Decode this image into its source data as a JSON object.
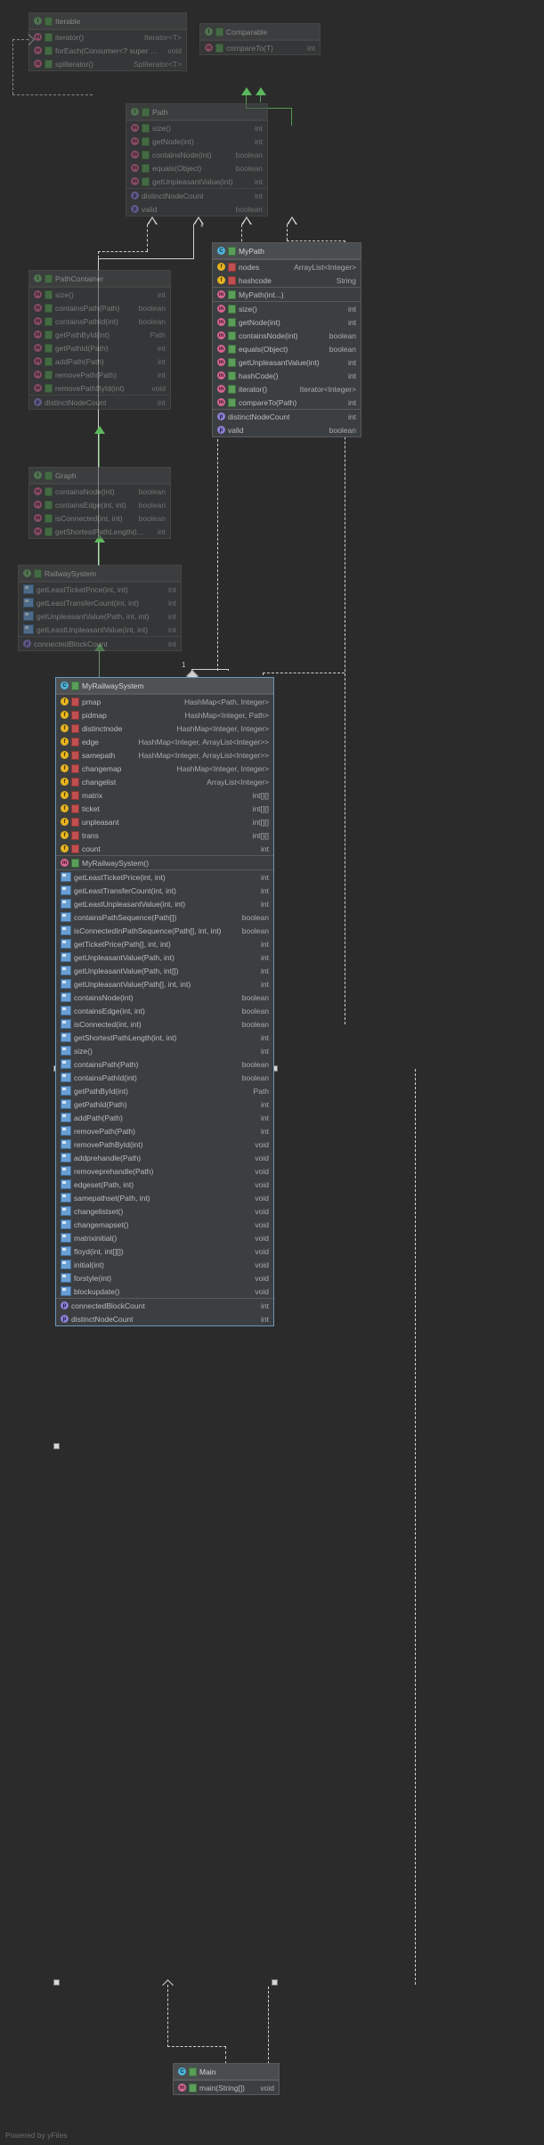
{
  "footer": {
    "text": "Powered by yFiles"
  },
  "classes": {
    "iterable": {
      "name": "Iterable",
      "kind": "interface",
      "members": [
        {
          "name": "iterator()",
          "type": "Iterator<T>",
          "icon": "method-icon",
          "vis": "public"
        },
        {
          "name": "forEach(Consumer<? super T>)",
          "type": "void",
          "icon": "method-icon",
          "vis": "public"
        },
        {
          "name": "spliterator()",
          "type": "Spliterator<T>",
          "icon": "method-icon",
          "vis": "public"
        }
      ]
    },
    "comparable": {
      "name": "Comparable",
      "kind": "interface",
      "members": [
        {
          "name": "compareTo(T)",
          "type": "int",
          "icon": "method-icon",
          "vis": "public"
        }
      ]
    },
    "path": {
      "name": "Path",
      "kind": "interface",
      "methods": [
        {
          "name": "size()",
          "type": "int",
          "icon": "method-icon",
          "vis": "public"
        },
        {
          "name": "getNode(int)",
          "type": "int",
          "icon": "method-icon",
          "vis": "public"
        },
        {
          "name": "containsNode(int)",
          "type": "boolean",
          "icon": "method-icon",
          "vis": "public"
        },
        {
          "name": "equals(Object)",
          "type": "boolean",
          "icon": "method-icon",
          "vis": "public"
        },
        {
          "name": "getUnpleasantValue(int)",
          "type": "int",
          "icon": "method-icon",
          "vis": "public"
        }
      ],
      "props": [
        {
          "name": "distinctNodeCount",
          "type": "int",
          "icon": "property-icon"
        },
        {
          "name": "valid",
          "type": "boolean",
          "icon": "property-icon"
        }
      ]
    },
    "pathcontainer": {
      "name": "PathContainer",
      "kind": "interface",
      "methods": [
        {
          "name": "size()",
          "type": "int",
          "icon": "method-icon",
          "vis": "public"
        },
        {
          "name": "containsPath(Path)",
          "type": "boolean",
          "icon": "method-icon",
          "vis": "public"
        },
        {
          "name": "containsPathId(int)",
          "type": "boolean",
          "icon": "method-icon",
          "vis": "public"
        },
        {
          "name": "getPathById(int)",
          "type": "Path",
          "icon": "method-icon",
          "vis": "public"
        },
        {
          "name": "getPathId(Path)",
          "type": "int",
          "icon": "method-icon",
          "vis": "public"
        },
        {
          "name": "addPath(Path)",
          "type": "int",
          "icon": "method-icon",
          "vis": "public"
        },
        {
          "name": "removePath(Path)",
          "type": "int",
          "icon": "method-icon",
          "vis": "public"
        },
        {
          "name": "removePathById(int)",
          "type": "void",
          "icon": "method-icon",
          "vis": "public"
        }
      ],
      "props": [
        {
          "name": "distinctNodeCount",
          "type": "int",
          "icon": "property-icon"
        }
      ]
    },
    "graph": {
      "name": "Graph",
      "kind": "interface",
      "methods": [
        {
          "name": "containsNode(int)",
          "type": "boolean",
          "icon": "method-icon",
          "vis": "public"
        },
        {
          "name": "containsEdge(int, int)",
          "type": "boolean",
          "icon": "method-icon",
          "vis": "public"
        },
        {
          "name": "isConnected(int, int)",
          "type": "boolean",
          "icon": "method-icon",
          "vis": "public"
        },
        {
          "name": "getShortestPathLength(int, int)",
          "type": "int",
          "icon": "method-icon",
          "vis": "public"
        }
      ]
    },
    "railwaysystem": {
      "name": "RailwaySystem",
      "kind": "interface",
      "methods": [
        {
          "name": "getLeastTicketPrice(int, int)",
          "type": "int",
          "icon": "override-icon"
        },
        {
          "name": "getLeastTransferCount(int, int)",
          "type": "int",
          "icon": "override-icon"
        },
        {
          "name": "getUnpleasantValue(Path, int, int)",
          "type": "int",
          "icon": "override-icon"
        },
        {
          "name": "getLeastUnpleasantValue(int, int)",
          "type": "int",
          "icon": "override-icon"
        }
      ],
      "props": [
        {
          "name": "connectedBlockCount",
          "type": "int",
          "icon": "property-icon"
        }
      ]
    },
    "mypath": {
      "name": "MyPath",
      "kind": "class",
      "fields": [
        {
          "name": "nodes",
          "type": "ArrayList<Integer>",
          "icon": "field-icon",
          "vis": "private"
        },
        {
          "name": "hashcode",
          "type": "String",
          "icon": "field-icon",
          "vis": "private"
        }
      ],
      "ctor": [
        {
          "name": "MyPath(int...)",
          "type": "",
          "icon": "method-icon",
          "vis": "public"
        }
      ],
      "methods": [
        {
          "name": "size()",
          "type": "int",
          "icon": "method-icon",
          "vis": "public"
        },
        {
          "name": "getNode(int)",
          "type": "int",
          "icon": "method-icon",
          "vis": "public"
        },
        {
          "name": "containsNode(int)",
          "type": "boolean",
          "icon": "method-icon",
          "vis": "public"
        },
        {
          "name": "equals(Object)",
          "type": "boolean",
          "icon": "method-icon",
          "vis": "public"
        },
        {
          "name": "getUnpleasantValue(int)",
          "type": "int",
          "icon": "method-icon",
          "vis": "public"
        },
        {
          "name": "hashCode()",
          "type": "int",
          "icon": "method-icon",
          "vis": "public"
        },
        {
          "name": "iterator()",
          "type": "Iterator<Integer>",
          "icon": "method-icon",
          "vis": "public"
        },
        {
          "name": "compareTo(Path)",
          "type": "int",
          "icon": "method-icon",
          "vis": "public"
        }
      ],
      "props": [
        {
          "name": "distinctNodeCount",
          "type": "int",
          "icon": "property-icon"
        },
        {
          "name": "valid",
          "type": "boolean",
          "icon": "property-icon"
        }
      ]
    },
    "myrailwaysystem": {
      "name": "MyRailwaySystem",
      "kind": "class",
      "selected": true,
      "fields": [
        {
          "name": "pmap",
          "type": "HashMap<Path, Integer>",
          "icon": "field-icon",
          "vis": "private"
        },
        {
          "name": "pidmap",
          "type": "HashMap<Integer, Path>",
          "icon": "field-icon",
          "vis": "private"
        },
        {
          "name": "distinctnode",
          "type": "HashMap<Integer, Integer>",
          "icon": "field-icon",
          "vis": "private"
        },
        {
          "name": "edge",
          "type": "HashMap<Integer, ArrayList<Integer>>",
          "icon": "field-icon",
          "vis": "private"
        },
        {
          "name": "samepath",
          "type": "HashMap<Integer, ArrayList<Integer>>",
          "icon": "field-icon",
          "vis": "private"
        },
        {
          "name": "changemap",
          "type": "HashMap<Integer, Integer>",
          "icon": "field-icon",
          "vis": "private"
        },
        {
          "name": "changelist",
          "type": "ArrayList<Integer>",
          "icon": "field-icon",
          "vis": "private"
        },
        {
          "name": "matrix",
          "type": "int[][]",
          "icon": "field-icon",
          "vis": "private"
        },
        {
          "name": "ticket",
          "type": "int[][]",
          "icon": "field-icon",
          "vis": "private"
        },
        {
          "name": "unpleasant",
          "type": "int[][]",
          "icon": "field-icon",
          "vis": "private"
        },
        {
          "name": "trans",
          "type": "int[][]",
          "icon": "field-icon",
          "vis": "private"
        },
        {
          "name": "count",
          "type": "int",
          "icon": "field-icon",
          "vis": "private"
        }
      ],
      "ctor": [
        {
          "name": "MyRailwaySystem()",
          "type": "",
          "icon": "method-icon",
          "vis": "public"
        }
      ],
      "methods": [
        {
          "name": "getLeastTicketPrice(int, int)",
          "type": "int",
          "icon": "override-icon"
        },
        {
          "name": "getLeastTransferCount(int, int)",
          "type": "int",
          "icon": "override-icon"
        },
        {
          "name": "getLeastUnpleasantValue(int, int)",
          "type": "int",
          "icon": "override-icon"
        },
        {
          "name": "containsPathSequence(Path[])",
          "type": "boolean",
          "icon": "override-icon"
        },
        {
          "name": "isConnectedInPathSequence(Path[], int, int)",
          "type": "boolean",
          "icon": "override-icon"
        },
        {
          "name": "getTicketPrice(Path[], int, int)",
          "type": "int",
          "icon": "override-icon"
        },
        {
          "name": "getUnpleasantValue(Path, int)",
          "type": "int",
          "icon": "override-icon"
        },
        {
          "name": "getUnpleasantValue(Path, int[])",
          "type": "int",
          "icon": "override-icon"
        },
        {
          "name": "getUnpleasantValue(Path[], int, int)",
          "type": "int",
          "icon": "override-icon"
        },
        {
          "name": "containsNode(int)",
          "type": "boolean",
          "icon": "override-icon"
        },
        {
          "name": "containsEdge(int, int)",
          "type": "boolean",
          "icon": "override-icon"
        },
        {
          "name": "isConnected(int, int)",
          "type": "boolean",
          "icon": "override-icon"
        },
        {
          "name": "getShortestPathLength(int, int)",
          "type": "int",
          "icon": "override-icon"
        },
        {
          "name": "size()",
          "type": "int",
          "icon": "override-icon"
        },
        {
          "name": "containsPath(Path)",
          "type": "boolean",
          "icon": "override-icon"
        },
        {
          "name": "containsPathId(int)",
          "type": "boolean",
          "icon": "override-icon"
        },
        {
          "name": "getPathById(int)",
          "type": "Path",
          "icon": "override-icon"
        },
        {
          "name": "getPathId(Path)",
          "type": "int",
          "icon": "override-icon"
        },
        {
          "name": "addPath(Path)",
          "type": "int",
          "icon": "override-icon"
        },
        {
          "name": "removePath(Path)",
          "type": "int",
          "icon": "override-icon"
        },
        {
          "name": "removePathById(int)",
          "type": "void",
          "icon": "override-icon"
        },
        {
          "name": "addprehandle(Path)",
          "type": "void",
          "icon": "override-icon"
        },
        {
          "name": "removeprehandle(Path)",
          "type": "void",
          "icon": "override-icon"
        },
        {
          "name": "edgeset(Path, int)",
          "type": "void",
          "icon": "override-icon"
        },
        {
          "name": "samepathset(Path, int)",
          "type": "void",
          "icon": "override-icon"
        },
        {
          "name": "changelistset()",
          "type": "void",
          "icon": "override-icon"
        },
        {
          "name": "changemapset()",
          "type": "void",
          "icon": "override-icon"
        },
        {
          "name": "matrixinitial()",
          "type": "void",
          "icon": "override-icon"
        },
        {
          "name": "floyd(int, int[][])",
          "type": "void",
          "icon": "override-icon"
        },
        {
          "name": "initial(int)",
          "type": "void",
          "icon": "override-icon"
        },
        {
          "name": "forstyle(int)",
          "type": "void",
          "icon": "override-icon"
        },
        {
          "name": "blockupdate()",
          "type": "void",
          "icon": "override-icon"
        }
      ],
      "props": [
        {
          "name": "connectedBlockCount",
          "type": "int",
          "icon": "property-icon"
        },
        {
          "name": "distinctNodeCount",
          "type": "int",
          "icon": "property-icon"
        }
      ]
    },
    "main": {
      "name": "Main",
      "kind": "class",
      "methods": [
        {
          "name": "main(String[])",
          "type": "void",
          "icon": "method-icon",
          "vis": "public"
        }
      ]
    }
  },
  "edges": {
    "multiplicity_one": "1",
    "multiplicity_many": "*"
  },
  "colors": {
    "background": "#2b2b2b",
    "box_body": "#3c3f41",
    "box_header": "#4a4d4f",
    "border": "#5a5a5a",
    "inherit_green": "#5cb85c",
    "selection": "#6897bb"
  }
}
